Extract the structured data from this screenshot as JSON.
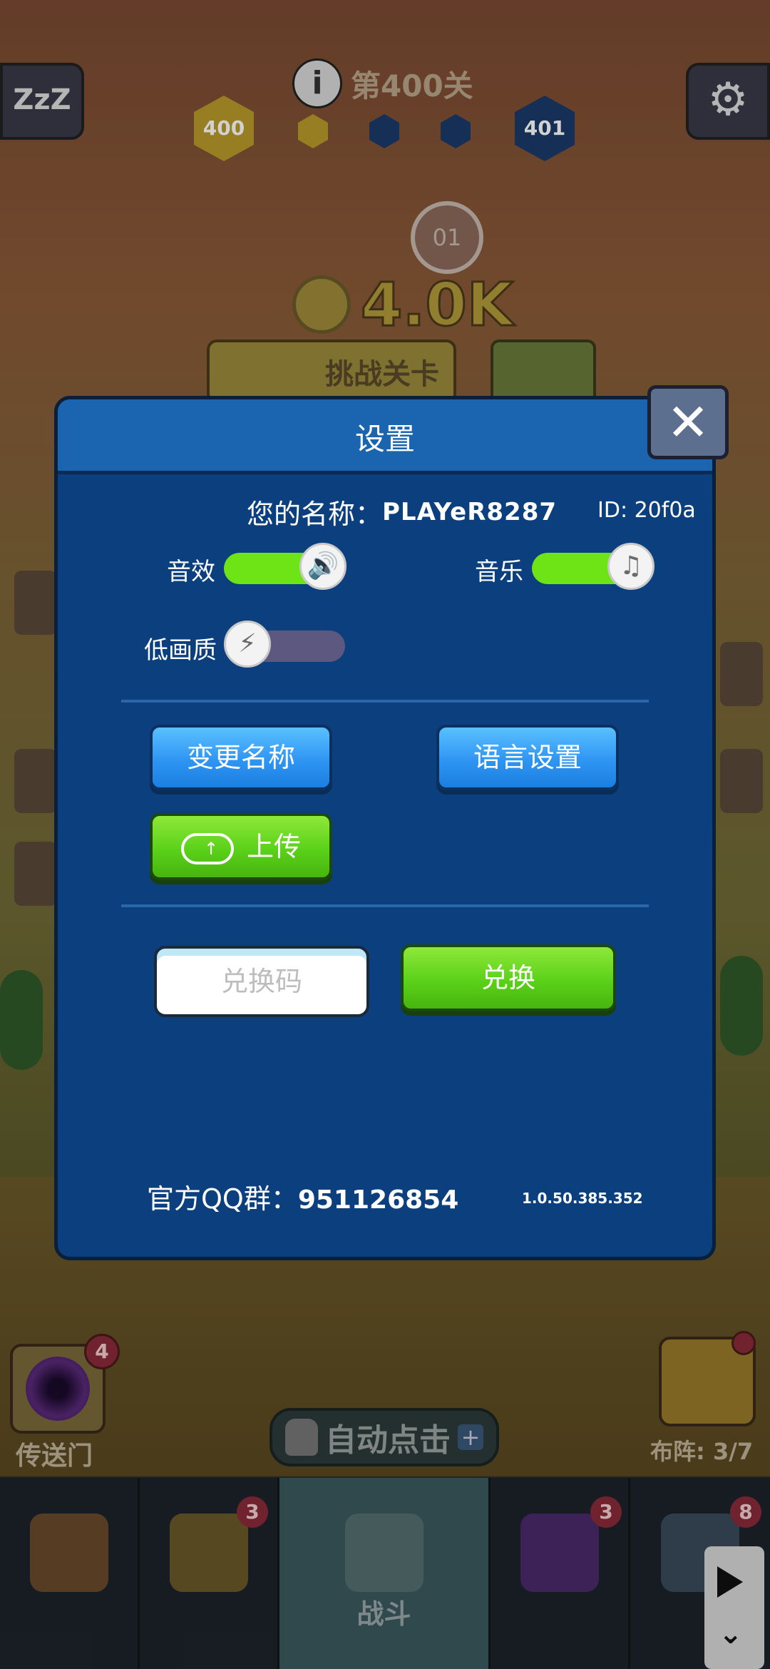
{
  "hud": {
    "sleep_label": "ZzZ",
    "level_title": "第400关",
    "level_current": "400",
    "level_next": "401",
    "target_label": "01",
    "coin_amount": "4.0K",
    "challenge_label": "挑战关卡"
  },
  "dialog": {
    "title": "设置",
    "close_label": "✕",
    "name_label": "您的名称：",
    "name_value": "PLAYeR8287",
    "id_text": "ID:  20f0a",
    "sound_label": "音效",
    "music_label": "音乐",
    "low_quality_label": "低画质",
    "sound_on": true,
    "music_on": true,
    "low_quality_on": false,
    "change_name_label": "变更名称",
    "language_label": "语言设置",
    "upload_label": "上传",
    "redeem_placeholder": "兑换码",
    "redeem_button_label": "兑换",
    "qq_label": "官方QQ群：",
    "qq_number": "951126854",
    "version": "1.0.50.385.352"
  },
  "bottom": {
    "portal_label": "传送门",
    "portal_badge": "4",
    "formation_label": "布阵: 3/7",
    "auto_click_label": "自动点击"
  },
  "nav": {
    "items": [
      {
        "label": "",
        "badge": ""
      },
      {
        "label": "",
        "badge": "3"
      },
      {
        "label": "战斗",
        "badge": ""
      },
      {
        "label": "",
        "badge": "3"
      },
      {
        "label": "",
        "badge": "8"
      }
    ]
  },
  "colors": {
    "dialog_bg": "#0b3f7e",
    "header_bg": "#1a64b0",
    "toggle_on": "#6ee416",
    "toggle_off": "#5c5880",
    "button_blue": "#2f95f3",
    "button_green": "#5bd11a"
  }
}
